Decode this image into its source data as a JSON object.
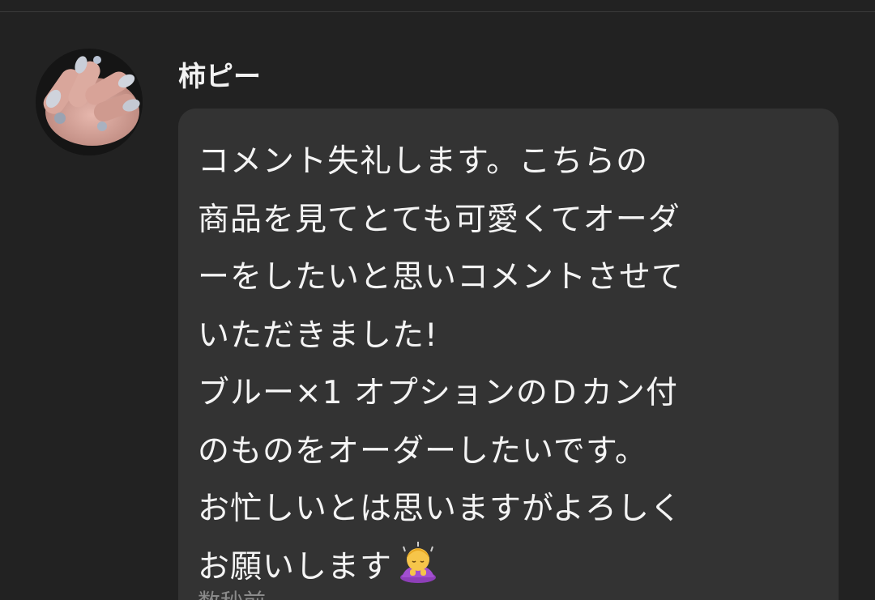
{
  "comment": {
    "author": {
      "name": "柿ピー",
      "avatar_icon": "avatar-nail-photo"
    },
    "message": "コメント失礼します。こちらの\n商品を見てとても可愛くてオーダ\nーをしたいと思いコメントさせて\nいただきました!\nブルー×1 オプションのＤカン付\nのものをオーダーしたいです。\nお忙しいとは思いますがよろしく\nお願いします",
    "emoji_icon": "person-bowing-emoji",
    "meta_text": "数秒前"
  },
  "colors": {
    "background": "#222222",
    "bubble": "#333333",
    "text": "#f4f4f4",
    "meta": "#8a8a8a"
  }
}
